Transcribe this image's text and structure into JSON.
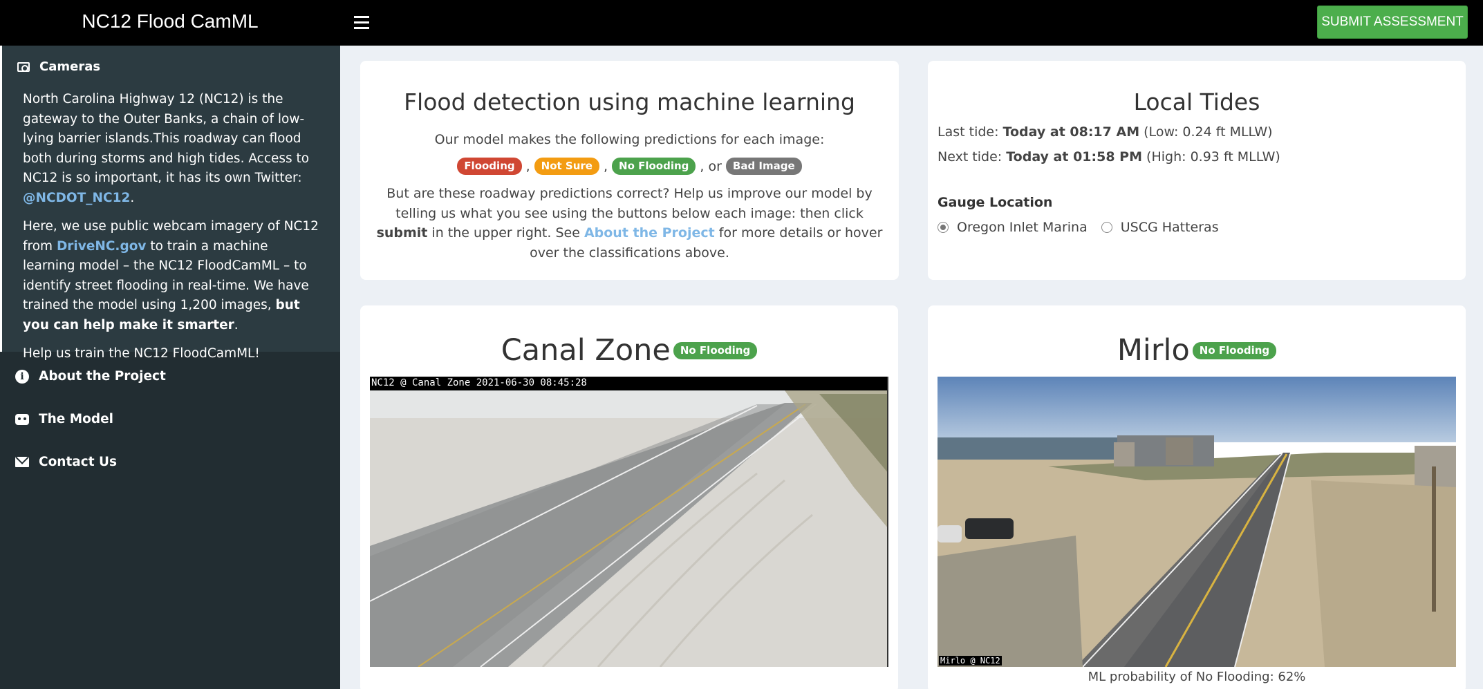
{
  "app": {
    "title": "NC12 Flood CamML",
    "submit_label": "SUBMIT ASSESSMENT"
  },
  "sidebar": {
    "cameras_label": "Cameras",
    "p1_text": "North Carolina Highway 12 (NC12) is the gateway to the Outer Banks, a chain of low-lying barrier islands.This roadway can flood both during storms and high tides. Access to NC12 is so important, it has its own Twitter: ",
    "p1_link": "@NCDOT_NC12",
    "p1_end": ".",
    "p2_a": "Here, we use public webcam imagery of NC12 from ",
    "p2_link": "DriveNC.gov",
    "p2_b": " to train a machine learning model – the NC12 FloodCamML – to identify street flooding in real-time. We have trained the model using 1,200 images, ",
    "p2_bold": "but you can help make it smarter",
    "p2_end": ".",
    "p3": "Help us train the NC12 FloodCamML!",
    "items": [
      {
        "label": "About the Project",
        "icon": "info-icon"
      },
      {
        "label": "The Model",
        "icon": "robot-icon"
      },
      {
        "label": "Contact Us",
        "icon": "envelope-icon"
      }
    ]
  },
  "info": {
    "title": "Flood detection using machine learning",
    "subtitle": "Our model makes the following predictions for each image:",
    "badges": [
      "Flooding",
      "Not Sure",
      "No Flooding",
      "Bad Image"
    ],
    "sep1": ",",
    "sep2": ",",
    "sep3": ", or",
    "para_a": "But are these roadway predictions correct? Help us improve our model by telling us what you see using the buttons below each image: then click ",
    "para_bold": "submit",
    "para_b": " in the upper right. See ",
    "para_link": "About the Project",
    "para_c": " for more details or hover over the classifications above."
  },
  "tides": {
    "title": "Local Tides",
    "last_label": "Last tide: ",
    "last_time": "Today at 08:17 AM",
    "last_detail": " (Low: 0.24 ft MLLW)",
    "next_label": "Next tide: ",
    "next_time": "Today at 01:58 PM",
    "next_detail": " (High: 0.93 ft MLLW)",
    "gauge_label": "Gauge Location",
    "options": [
      "Oregon Inlet Marina",
      "USCG Hatteras"
    ],
    "selected": "Oregon Inlet Marina"
  },
  "cameras": [
    {
      "name": "Canal Zone",
      "status": "No Flooding",
      "overlay": "NC12 @ Canal Zone 2021-06-30 08:45:28"
    },
    {
      "name": "Mirlo",
      "status": "No Flooding",
      "overlay": "Mirlo @ NC12",
      "probability": "ML probability of No Flooding: 62%"
    }
  ],
  "colors": {
    "flooding": "#d04733",
    "not_sure": "#f39c12",
    "no_flooding": "#4ca24c",
    "bad_image": "#777777",
    "link": "#7fb7e6"
  }
}
